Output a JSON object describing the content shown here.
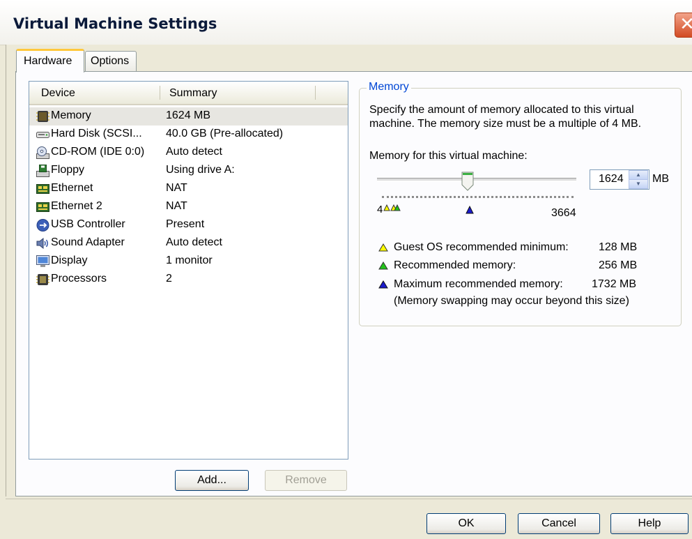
{
  "window": {
    "title": "Virtual Machine Settings",
    "close_glyph": "✕"
  },
  "tabs": [
    {
      "label": "Hardware",
      "active": true
    },
    {
      "label": "Options",
      "active": false
    }
  ],
  "device_list": {
    "headers": {
      "device": "Device",
      "summary": "Summary"
    },
    "rows": [
      {
        "icon": "memory-icon",
        "name": "Memory",
        "summary": "1624 MB",
        "selected": true
      },
      {
        "icon": "hard-disk-icon",
        "name": "Hard Disk (SCSI...",
        "summary": "40.0 GB (Pre-allocated)",
        "selected": false
      },
      {
        "icon": "cd-rom-icon",
        "name": "CD-ROM (IDE 0:0)",
        "summary": "Auto detect",
        "selected": false
      },
      {
        "icon": "floppy-icon",
        "name": "Floppy",
        "summary": "Using drive A:",
        "selected": false
      },
      {
        "icon": "ethernet-icon",
        "name": "Ethernet",
        "summary": "NAT",
        "selected": false
      },
      {
        "icon": "ethernet-icon",
        "name": "Ethernet 2",
        "summary": "NAT",
        "selected": false
      },
      {
        "icon": "usb-icon",
        "name": "USB Controller",
        "summary": "Present",
        "selected": false
      },
      {
        "icon": "sound-icon",
        "name": "Sound Adapter",
        "summary": "Auto detect",
        "selected": false
      },
      {
        "icon": "display-icon",
        "name": "Display",
        "summary": "1 monitor",
        "selected": false
      },
      {
        "icon": "processor-icon",
        "name": "Processors",
        "summary": "2",
        "selected": false
      }
    ],
    "add_label": "Add...",
    "remove_label": "Remove"
  },
  "memory": {
    "group_title": "Memory",
    "description": "Specify the amount of memory allocated to this virtual machine. The memory size must be a multiple of 4 MB.",
    "field_label": "Memory for this virtual machine:",
    "value": "1624",
    "unit": "MB",
    "scale_min": "4",
    "scale_max": "3664",
    "legend": [
      {
        "color": "#ffff00",
        "label": "Guest OS recommended minimum:",
        "value": "128 MB"
      },
      {
        "color": "#22c21a",
        "label": "Recommended memory:",
        "value": "256 MB"
      },
      {
        "color": "#1a1acc",
        "label": "Maximum recommended memory:",
        "value": "1732 MB"
      }
    ],
    "swap_note": "(Memory swapping may occur beyond this size)"
  },
  "footer": {
    "ok_label": "OK",
    "cancel_label": "Cancel",
    "help_label": "Help"
  }
}
